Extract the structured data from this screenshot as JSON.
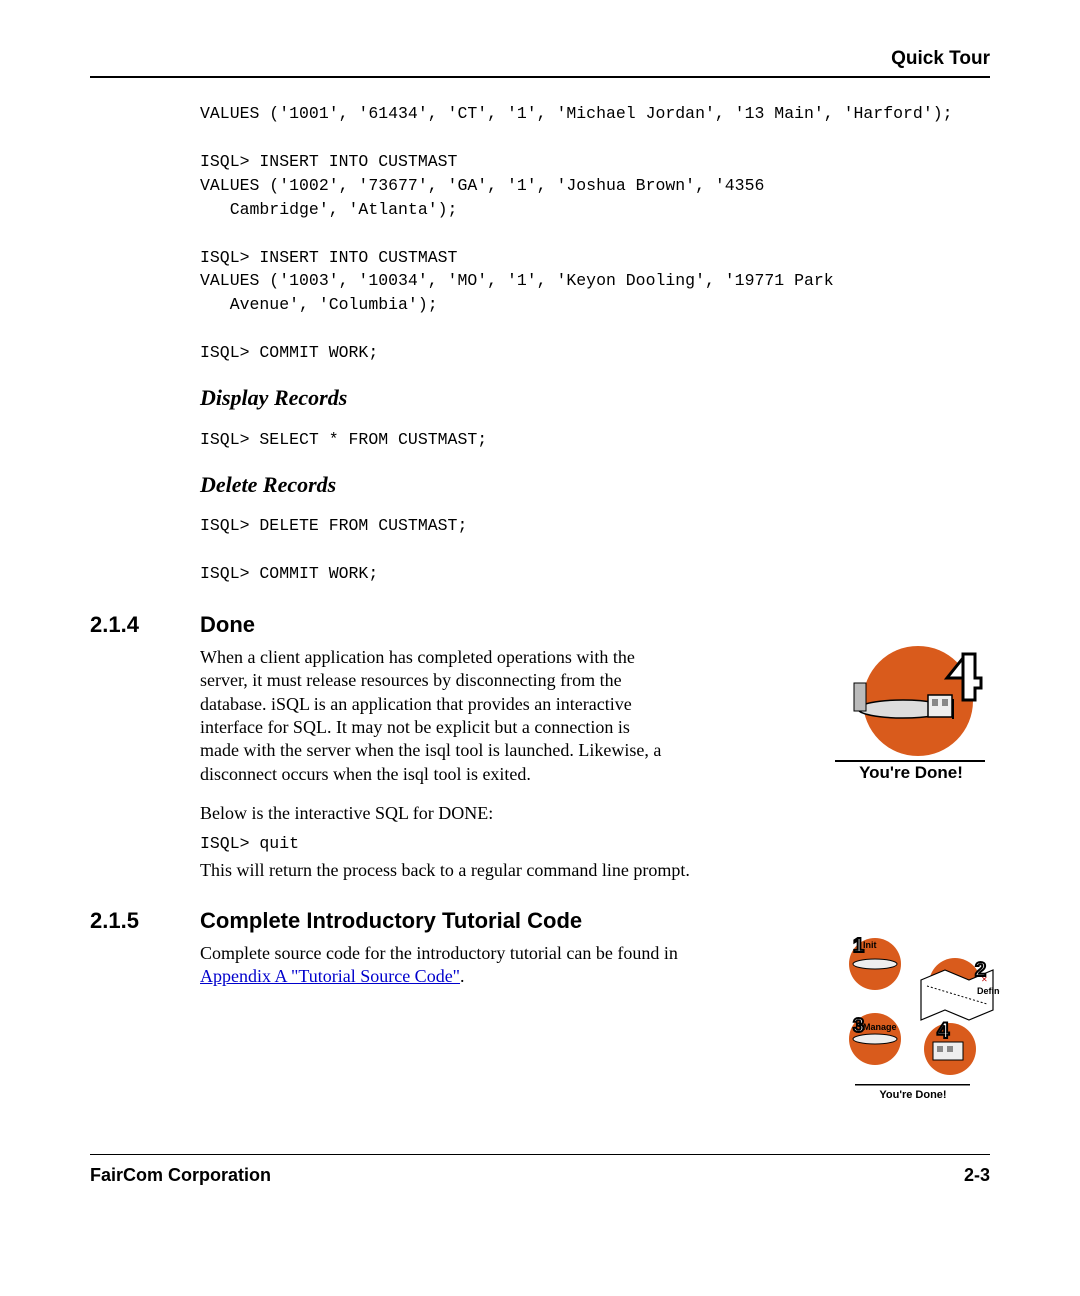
{
  "header": {
    "title": "Quick Tour"
  },
  "code_block1": "VALUES ('1001', '61434', 'CT', '1', 'Michael Jordan', '13 Main', 'Harford');\n\nISQL> INSERT INTO CUSTMAST\nVALUES ('1002', '73677', 'GA', '1', 'Joshua Brown', '4356\n   Cambridge', 'Atlanta');\n\nISQL> INSERT INTO CUSTMAST\nVALUES ('1003', '10034', 'MO', '1', 'Keyon Dooling', '19771 Park\n   Avenue', 'Columbia');\n\nISQL> COMMIT WORK;",
  "display": {
    "title": "Display Records",
    "code": "ISQL> SELECT * FROM CUSTMAST;"
  },
  "delete": {
    "title": "Delete Records",
    "code": "ISQL> DELETE FROM CUSTMAST;\n\nISQL> COMMIT WORK;"
  },
  "done": {
    "num": "2.1.4",
    "title": "Done",
    "para": "When a client application has completed operations with the server, it must release resources by disconnecting from the database.  iSQL is an application that provides an interactive interface for  SQL.  It may not be explicit but a connection is made with the server when the isql tool is launched.  Likewise, a disconnect occurs when the isql tool is exited.",
    "img_caption": "You're Done!",
    "below": "Below is the interactive SQL for DONE:",
    "code": "ISQL> quit",
    "after": "This will return the process back to a regular command line prompt."
  },
  "tutorial": {
    "num": "2.1.5",
    "title": "Complete Introductory Tutorial Code",
    "para_before": "Complete source code for the introductory tutorial can be found in ",
    "link": "Appendix A \"Tutorial Source Code\"",
    "para_after": ".",
    "labels": {
      "init": "Init",
      "define": "Define",
      "manage": "Manage",
      "caption": "You're Done!"
    }
  },
  "footer": {
    "company": "FairCom Corporation",
    "page": "2-3"
  }
}
